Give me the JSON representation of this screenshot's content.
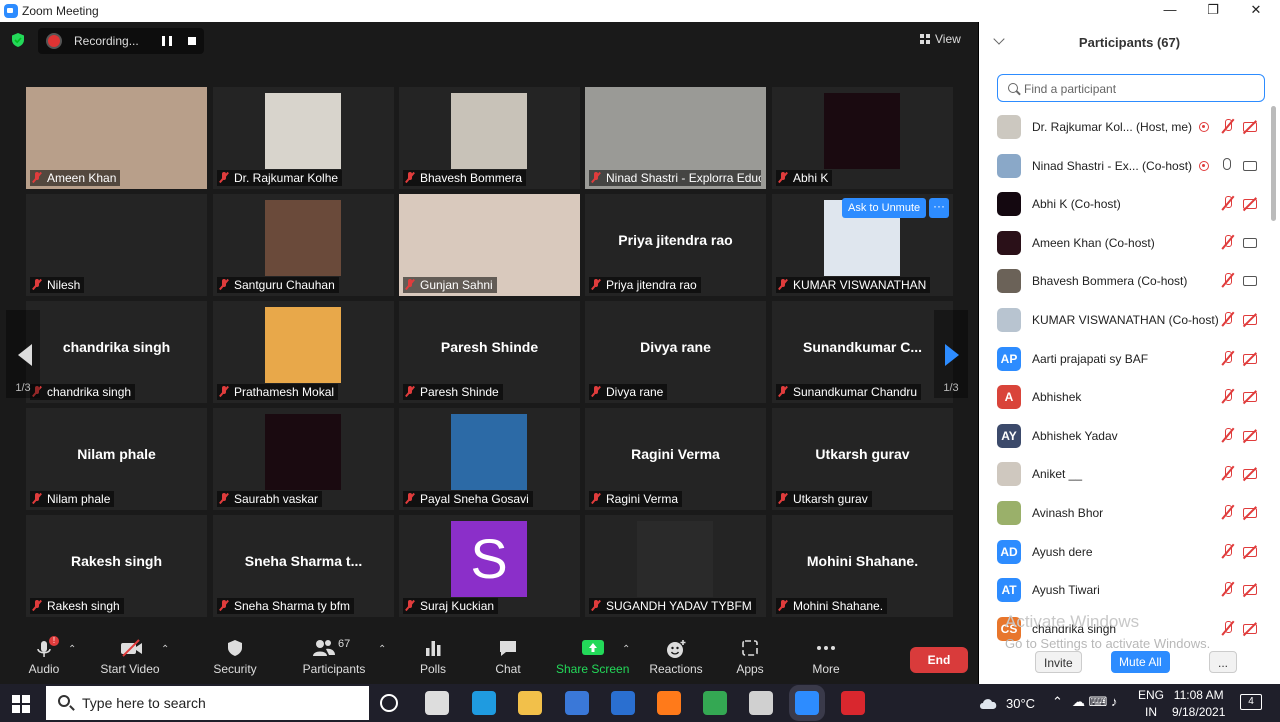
{
  "window": {
    "title": "Zoom Meeting",
    "controls": [
      "—",
      "❐",
      "✕"
    ]
  },
  "meeting": {
    "recording_label": "Recording...",
    "view_label": "View",
    "ask_to_unmute": "Ask to Unmute",
    "more_label": "···",
    "page_indicator": "1/3",
    "tiles": [
      {
        "name": "Ameen Khan",
        "kind": "video",
        "color": "#b89f8a"
      },
      {
        "name": "Dr. Rajkumar Kolhe",
        "kind": "photo",
        "color": "#d8d4cc"
      },
      {
        "name": "Bhavesh Bommera",
        "kind": "photo",
        "color": "#c8c2b8"
      },
      {
        "name": "Ninad Shastri - Explorra Educ...",
        "kind": "video",
        "color": "#9a9a96",
        "active": true
      },
      {
        "name": "Abhi K",
        "kind": "photo",
        "color": "#1a0a10"
      },
      {
        "name": "Nilesh",
        "kind": "name"
      },
      {
        "name": "Santguru Chauhan",
        "kind": "photo",
        "color": "#6a4a3a"
      },
      {
        "name": "Gunjan Sahni",
        "kind": "video",
        "color": "#d9c9bd"
      },
      {
        "name": "Priya jitendra rao",
        "kind": "name",
        "big": "Priya jitendra rao"
      },
      {
        "name": "KUMAR VISWANATHAN",
        "kind": "photo",
        "color": "#dfe6ee"
      },
      {
        "name": "chandrika singh",
        "kind": "name",
        "big": "chandrika singh"
      },
      {
        "name": "Prathamesh Mokal",
        "kind": "photo",
        "color": "#e8a84a"
      },
      {
        "name": "Paresh Shinde",
        "kind": "name",
        "big": "Paresh Shinde"
      },
      {
        "name": "Divya rane",
        "kind": "name",
        "big": "Divya rane"
      },
      {
        "name": "Sunandkumar Chandru",
        "kind": "name",
        "big": "Sunandkumar  C..."
      },
      {
        "name": "Nilam phale",
        "kind": "name",
        "big": "Nilam phale"
      },
      {
        "name": "Saurabh vaskar",
        "kind": "photo",
        "color": "#1a0a10"
      },
      {
        "name": "Payal Sneha Gosavi",
        "kind": "photo",
        "color": "#2c6aa6"
      },
      {
        "name": "Ragini Verma",
        "kind": "name",
        "big": "Ragini Verma"
      },
      {
        "name": "Utkarsh gurav",
        "kind": "name",
        "big": "Utkarsh gurav"
      },
      {
        "name": "Rakesh singh",
        "kind": "name",
        "big": "Rakesh singh"
      },
      {
        "name": "Sneha Sharma ty bfm",
        "kind": "name",
        "big": "Sneha  Sharma  t..."
      },
      {
        "name": "Suraj Kuckian",
        "kind": "letter",
        "letter": "S",
        "color": "#8b2fc9"
      },
      {
        "name": "SUGANDH YADAV TYBFM",
        "kind": "photo",
        "color": "#2a2a2a"
      },
      {
        "name": "Mohini  Shahane.",
        "kind": "name",
        "big": "Mohini  Shahane."
      }
    ]
  },
  "toolbar": {
    "audio": "Audio",
    "start_video": "Start Video",
    "security": "Security",
    "participants": "Participants",
    "participants_count": "67",
    "polls": "Polls",
    "chat": "Chat",
    "share_screen": "Share Screen",
    "reactions": "Reactions",
    "apps": "Apps",
    "more": "More",
    "end": "End",
    "audio_badge": "!"
  },
  "participants_panel": {
    "title": "Participants (67)",
    "search_placeholder": "Find a participant",
    "items": [
      {
        "name": "Dr. Rajkumar Kol... (Host, me)",
        "avatar": "photo",
        "color": "#ccc8c0",
        "rec": true,
        "mic": "muted",
        "cam": "off"
      },
      {
        "name": "Ninad Shastri - Ex... (Co-host)",
        "avatar": "photo",
        "color": "#8aa8c8",
        "rec": true,
        "mic": "on",
        "cam": "on"
      },
      {
        "name": "Abhi K (Co-host)",
        "avatar": "photo",
        "color": "#140810",
        "mic": "muted",
        "cam": "off"
      },
      {
        "name": "Ameen Khan (Co-host)",
        "avatar": "photo",
        "color": "#2a1018",
        "mic": "muted",
        "cam": "on"
      },
      {
        "name": "Bhavesh Bommera (Co-host)",
        "avatar": "photo",
        "color": "#6b6258",
        "mic": "muted",
        "cam": "on"
      },
      {
        "name": "KUMAR VISWANATHAN (Co-host)",
        "avatar": "photo",
        "color": "#b8c4d0",
        "mic": "muted",
        "cam": "off"
      },
      {
        "name": "Aarti prajapati sy BAF",
        "avatar": "AP",
        "color": "#2d8cff",
        "mic": "muted",
        "cam": "off"
      },
      {
        "name": "Abhishek",
        "avatar": "A",
        "color": "#d9443a",
        "mic": "muted",
        "cam": "off"
      },
      {
        "name": "Abhishek Yadav",
        "avatar": "AY",
        "color": "#3c4a6b",
        "mic": "muted",
        "cam": "off"
      },
      {
        "name": "Aniket __",
        "avatar": "photo",
        "color": "#cfc8bf",
        "mic": "muted",
        "cam": "off"
      },
      {
        "name": "Avinash Bhor",
        "avatar": "photo",
        "color": "#9ab06a",
        "mic": "muted",
        "cam": "off"
      },
      {
        "name": "Ayush dere",
        "avatar": "AD",
        "color": "#2d8cff",
        "mic": "muted",
        "cam": "off"
      },
      {
        "name": "Ayush Tiwari",
        "avatar": "AT",
        "color": "#2d8cff",
        "mic": "muted",
        "cam": "off"
      },
      {
        "name": "chandrika singh",
        "avatar": "CS",
        "color": "#e8762c",
        "mic": "muted",
        "cam": "off"
      }
    ],
    "invite": "Invite",
    "mute_all": "Mute All",
    "footer_more": "...",
    "watermark_title": "Activate Windows",
    "watermark_sub": "Go to Settings to activate Windows."
  },
  "taskbar": {
    "search_placeholder": "Type here to search",
    "weather": "30°C",
    "language": "ENG",
    "region": "IN",
    "time": "11:08 AM",
    "date": "9/18/2021",
    "notifications": "4",
    "apps": [
      {
        "name": "task-view",
        "color": "#ffffff"
      },
      {
        "name": "widgets",
        "color": "#dddddd"
      },
      {
        "name": "edge",
        "color": "#1f9be0"
      },
      {
        "name": "file-explorer",
        "color": "#f2c04a"
      },
      {
        "name": "store",
        "color": "#3a78d8"
      },
      {
        "name": "mail",
        "color": "#2a6fd0"
      },
      {
        "name": "firefox",
        "color": "#ff7a1a"
      },
      {
        "name": "chrome",
        "color": "#34a853"
      },
      {
        "name": "photos",
        "color": "#d0d0d0"
      },
      {
        "name": "zoom",
        "color": "#2d8cff"
      },
      {
        "name": "wps",
        "color": "#d9272e"
      }
    ]
  }
}
